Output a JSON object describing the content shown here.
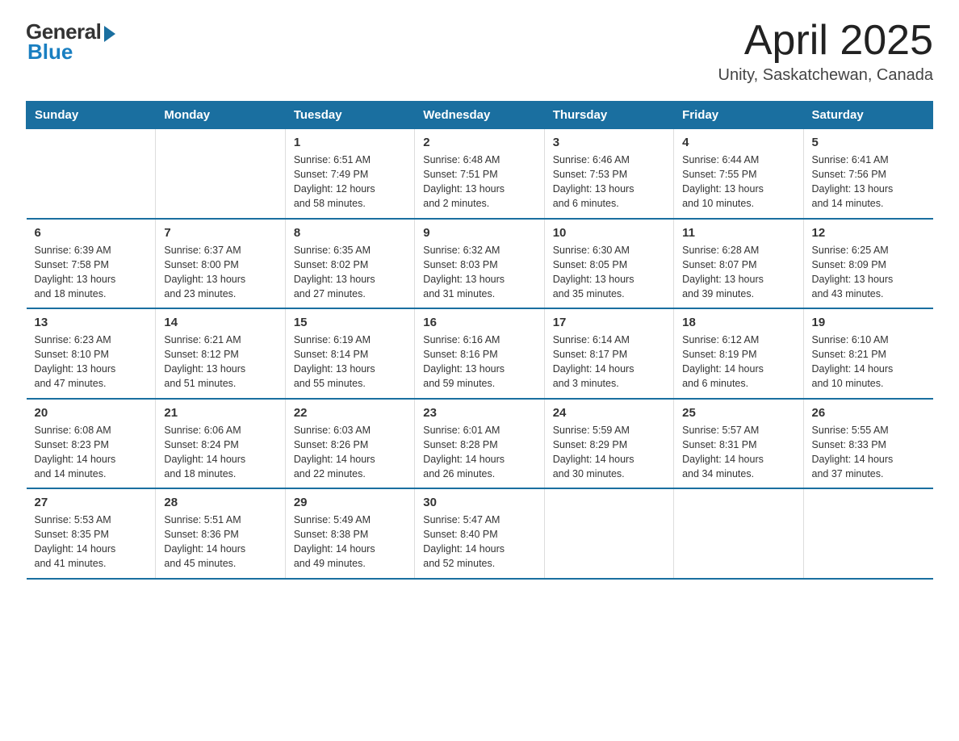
{
  "logo": {
    "general": "General",
    "blue": "Blue"
  },
  "title": "April 2025",
  "location": "Unity, Saskatchewan, Canada",
  "days_header": [
    "Sunday",
    "Monday",
    "Tuesday",
    "Wednesday",
    "Thursday",
    "Friday",
    "Saturday"
  ],
  "weeks": [
    [
      {
        "day": "",
        "info": ""
      },
      {
        "day": "",
        "info": ""
      },
      {
        "day": "1",
        "info": "Sunrise: 6:51 AM\nSunset: 7:49 PM\nDaylight: 12 hours\nand 58 minutes."
      },
      {
        "day": "2",
        "info": "Sunrise: 6:48 AM\nSunset: 7:51 PM\nDaylight: 13 hours\nand 2 minutes."
      },
      {
        "day": "3",
        "info": "Sunrise: 6:46 AM\nSunset: 7:53 PM\nDaylight: 13 hours\nand 6 minutes."
      },
      {
        "day": "4",
        "info": "Sunrise: 6:44 AM\nSunset: 7:55 PM\nDaylight: 13 hours\nand 10 minutes."
      },
      {
        "day": "5",
        "info": "Sunrise: 6:41 AM\nSunset: 7:56 PM\nDaylight: 13 hours\nand 14 minutes."
      }
    ],
    [
      {
        "day": "6",
        "info": "Sunrise: 6:39 AM\nSunset: 7:58 PM\nDaylight: 13 hours\nand 18 minutes."
      },
      {
        "day": "7",
        "info": "Sunrise: 6:37 AM\nSunset: 8:00 PM\nDaylight: 13 hours\nand 23 minutes."
      },
      {
        "day": "8",
        "info": "Sunrise: 6:35 AM\nSunset: 8:02 PM\nDaylight: 13 hours\nand 27 minutes."
      },
      {
        "day": "9",
        "info": "Sunrise: 6:32 AM\nSunset: 8:03 PM\nDaylight: 13 hours\nand 31 minutes."
      },
      {
        "day": "10",
        "info": "Sunrise: 6:30 AM\nSunset: 8:05 PM\nDaylight: 13 hours\nand 35 minutes."
      },
      {
        "day": "11",
        "info": "Sunrise: 6:28 AM\nSunset: 8:07 PM\nDaylight: 13 hours\nand 39 minutes."
      },
      {
        "day": "12",
        "info": "Sunrise: 6:25 AM\nSunset: 8:09 PM\nDaylight: 13 hours\nand 43 minutes."
      }
    ],
    [
      {
        "day": "13",
        "info": "Sunrise: 6:23 AM\nSunset: 8:10 PM\nDaylight: 13 hours\nand 47 minutes."
      },
      {
        "day": "14",
        "info": "Sunrise: 6:21 AM\nSunset: 8:12 PM\nDaylight: 13 hours\nand 51 minutes."
      },
      {
        "day": "15",
        "info": "Sunrise: 6:19 AM\nSunset: 8:14 PM\nDaylight: 13 hours\nand 55 minutes."
      },
      {
        "day": "16",
        "info": "Sunrise: 6:16 AM\nSunset: 8:16 PM\nDaylight: 13 hours\nand 59 minutes."
      },
      {
        "day": "17",
        "info": "Sunrise: 6:14 AM\nSunset: 8:17 PM\nDaylight: 14 hours\nand 3 minutes."
      },
      {
        "day": "18",
        "info": "Sunrise: 6:12 AM\nSunset: 8:19 PM\nDaylight: 14 hours\nand 6 minutes."
      },
      {
        "day": "19",
        "info": "Sunrise: 6:10 AM\nSunset: 8:21 PM\nDaylight: 14 hours\nand 10 minutes."
      }
    ],
    [
      {
        "day": "20",
        "info": "Sunrise: 6:08 AM\nSunset: 8:23 PM\nDaylight: 14 hours\nand 14 minutes."
      },
      {
        "day": "21",
        "info": "Sunrise: 6:06 AM\nSunset: 8:24 PM\nDaylight: 14 hours\nand 18 minutes."
      },
      {
        "day": "22",
        "info": "Sunrise: 6:03 AM\nSunset: 8:26 PM\nDaylight: 14 hours\nand 22 minutes."
      },
      {
        "day": "23",
        "info": "Sunrise: 6:01 AM\nSunset: 8:28 PM\nDaylight: 14 hours\nand 26 minutes."
      },
      {
        "day": "24",
        "info": "Sunrise: 5:59 AM\nSunset: 8:29 PM\nDaylight: 14 hours\nand 30 minutes."
      },
      {
        "day": "25",
        "info": "Sunrise: 5:57 AM\nSunset: 8:31 PM\nDaylight: 14 hours\nand 34 minutes."
      },
      {
        "day": "26",
        "info": "Sunrise: 5:55 AM\nSunset: 8:33 PM\nDaylight: 14 hours\nand 37 minutes."
      }
    ],
    [
      {
        "day": "27",
        "info": "Sunrise: 5:53 AM\nSunset: 8:35 PM\nDaylight: 14 hours\nand 41 minutes."
      },
      {
        "day": "28",
        "info": "Sunrise: 5:51 AM\nSunset: 8:36 PM\nDaylight: 14 hours\nand 45 minutes."
      },
      {
        "day": "29",
        "info": "Sunrise: 5:49 AM\nSunset: 8:38 PM\nDaylight: 14 hours\nand 49 minutes."
      },
      {
        "day": "30",
        "info": "Sunrise: 5:47 AM\nSunset: 8:40 PM\nDaylight: 14 hours\nand 52 minutes."
      },
      {
        "day": "",
        "info": ""
      },
      {
        "day": "",
        "info": ""
      },
      {
        "day": "",
        "info": ""
      }
    ]
  ]
}
